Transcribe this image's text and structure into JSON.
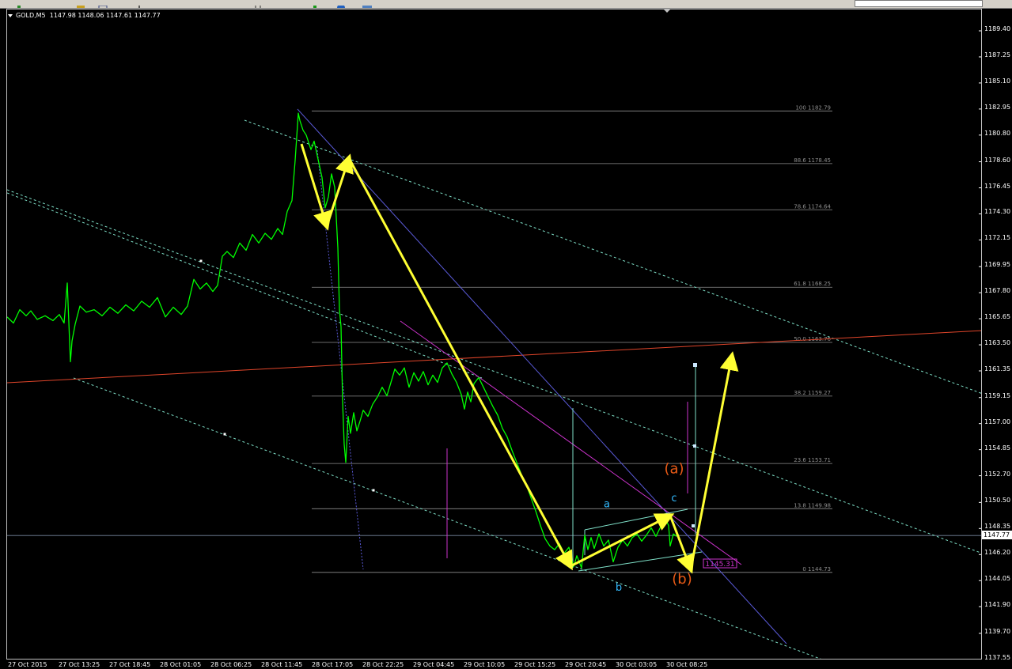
{
  "header": {
    "symbol": "GOLD,M5",
    "ohlc": "1147.98 1148.06 1147.61 1147.77"
  },
  "toolbar": {
    "buttons": [
      "new-chart-icon",
      "profiles-icon",
      "crosshair-icon",
      "zoom-in-icon",
      "zoom-out-icon",
      "period-icon",
      "new-order-icon",
      "autotrading-icon",
      "indicators-icon"
    ]
  },
  "colors": {
    "background": "#000000",
    "price_line": "#00ff00",
    "wave_arrow": "#ffff33",
    "fib_level": "#8e8e8e",
    "channel": "#7fe0c8",
    "trendline_blue": "#5a5ad8",
    "trendline_magenta": "#cc33cc",
    "trendline_red": "#e0452a",
    "label_orange": "#e85a16",
    "label_cyan": "#33bbff",
    "axis_text": "#ffffff"
  },
  "chart_data": {
    "type": "line",
    "title": "GOLD,M5",
    "y_axis": {
      "ticks": [
        "1189.40",
        "1187.25",
        "1185.10",
        "1182.95",
        "1180.80",
        "1178.60",
        "1176.45",
        "1174.30",
        "1172.15",
        "1169.95",
        "1167.80",
        "1165.65",
        "1163.50",
        "1161.35",
        "1159.15",
        "1157.00",
        "1154.85",
        "1152.70",
        "1150.50",
        "1148.35",
        "1146.20",
        "1144.05",
        "1141.90",
        "1139.70",
        "1137.55"
      ],
      "current_price": "1147.77",
      "ylim": [
        1137.0,
        1190.5
      ]
    },
    "x_axis": {
      "ticks": [
        "27 Oct 2015",
        "27 Oct 13:25",
        "27 Oct 18:45",
        "28 Oct 01:05",
        "28 Oct 06:25",
        "28 Oct 11:45",
        "28 Oct 17:05",
        "28 Oct 22:25",
        "29 Oct 04:45",
        "29 Oct 10:05",
        "29 Oct 15:25",
        "29 Oct 20:45",
        "30 Oct 03:05",
        "30 Oct 08:25"
      ]
    },
    "series": [
      {
        "values": [
          [
            0,
            1165.8
          ],
          [
            8,
            1165.3
          ],
          [
            16,
            1166.4
          ],
          [
            24,
            1165.9
          ],
          [
            30,
            1166.3
          ],
          [
            38,
            1165.6
          ],
          [
            48,
            1165.9
          ],
          [
            58,
            1165.5
          ],
          [
            66,
            1166.0
          ],
          [
            72,
            1165.3
          ],
          [
            76,
            1168.6
          ],
          [
            80,
            1162.1
          ],
          [
            82,
            1163.8
          ],
          [
            86,
            1165.2
          ],
          [
            92,
            1166.7
          ],
          [
            100,
            1166.2
          ],
          [
            110,
            1166.4
          ],
          [
            120,
            1165.9
          ],
          [
            130,
            1166.6
          ],
          [
            140,
            1166.1
          ],
          [
            150,
            1166.8
          ],
          [
            160,
            1166.3
          ],
          [
            170,
            1167.1
          ],
          [
            180,
            1166.6
          ],
          [
            190,
            1167.4
          ],
          [
            200,
            1165.8
          ],
          [
            210,
            1166.6
          ],
          [
            220,
            1166.0
          ],
          [
            228,
            1166.7
          ],
          [
            236,
            1168.9
          ],
          [
            244,
            1168.1
          ],
          [
            252,
            1168.6
          ],
          [
            260,
            1167.9
          ],
          [
            266,
            1168.4
          ],
          [
            272,
            1170.8
          ],
          [
            278,
            1171.2
          ],
          [
            286,
            1170.7
          ],
          [
            294,
            1171.9
          ],
          [
            302,
            1171.3
          ],
          [
            310,
            1172.6
          ],
          [
            318,
            1171.9
          ],
          [
            326,
            1172.7
          ],
          [
            334,
            1172.2
          ],
          [
            342,
            1173.1
          ],
          [
            348,
            1172.6
          ],
          [
            354,
            1174.5
          ],
          [
            360,
            1175.4
          ],
          [
            364,
            1178.7
          ],
          [
            368,
            1182.6
          ],
          [
            370,
            1182.0
          ],
          [
            374,
            1181.2
          ],
          [
            378,
            1180.8
          ],
          [
            384,
            1179.6
          ],
          [
            388,
            1180.3
          ],
          [
            394,
            1178.5
          ],
          [
            398,
            1177.3
          ],
          [
            402,
            1174.8
          ],
          [
            406,
            1175.7
          ],
          [
            410,
            1177.6
          ],
          [
            414,
            1176.5
          ],
          [
            418,
            1171.5
          ],
          [
            420,
            1166.4
          ],
          [
            422,
            1165.0
          ],
          [
            424,
            1158.8
          ],
          [
            426,
            1155.3
          ],
          [
            428,
            1153.8
          ],
          [
            431,
            1157.6
          ],
          [
            434,
            1156.2
          ],
          [
            438,
            1157.9
          ],
          [
            442,
            1156.4
          ],
          [
            446,
            1157.2
          ],
          [
            450,
            1158.1
          ],
          [
            456,
            1157.6
          ],
          [
            462,
            1158.6
          ],
          [
            468,
            1159.2
          ],
          [
            474,
            1160.0
          ],
          [
            480,
            1159.3
          ],
          [
            486,
            1160.6
          ],
          [
            490,
            1161.5
          ],
          [
            496,
            1161.0
          ],
          [
            502,
            1161.6
          ],
          [
            508,
            1160.0
          ],
          [
            514,
            1161.2
          ],
          [
            520,
            1160.5
          ],
          [
            526,
            1161.3
          ],
          [
            532,
            1160.2
          ],
          [
            538,
            1161.0
          ],
          [
            544,
            1160.4
          ],
          [
            550,
            1161.6
          ],
          [
            556,
            1162.0
          ],
          [
            562,
            1161.1
          ],
          [
            568,
            1160.4
          ],
          [
            574,
            1159.4
          ],
          [
            578,
            1158.2
          ],
          [
            582,
            1159.6
          ],
          [
            586,
            1158.8
          ],
          [
            590,
            1160.3
          ],
          [
            596,
            1160.8
          ],
          [
            602,
            1160.0
          ],
          [
            608,
            1159.2
          ],
          [
            614,
            1158.4
          ],
          [
            620,
            1157.7
          ],
          [
            626,
            1156.6
          ],
          [
            632,
            1155.9
          ],
          [
            638,
            1154.8
          ],
          [
            644,
            1153.8
          ],
          [
            650,
            1152.8
          ],
          [
            656,
            1152.0
          ],
          [
            662,
            1150.9
          ],
          [
            668,
            1149.8
          ],
          [
            674,
            1148.6
          ],
          [
            680,
            1147.5
          ],
          [
            686,
            1146.9
          ],
          [
            692,
            1146.6
          ],
          [
            698,
            1147.1
          ],
          [
            704,
            1146.3
          ],
          [
            710,
            1146.8
          ],
          [
            716,
            1145.2
          ],
          [
            720,
            1146.1
          ],
          [
            726,
            1145.1
          ],
          [
            730,
            1147.8
          ],
          [
            734,
            1146.6
          ],
          [
            738,
            1147.6
          ],
          [
            742,
            1146.7
          ],
          [
            748,
            1147.9
          ],
          [
            754,
            1146.9
          ],
          [
            760,
            1147.4
          ],
          [
            766,
            1145.6
          ],
          [
            772,
            1146.8
          ],
          [
            778,
            1147.4
          ],
          [
            784,
            1146.9
          ],
          [
            790,
            1147.6
          ],
          [
            796,
            1147.9
          ],
          [
            802,
            1147.3
          ],
          [
            808,
            1147.8
          ],
          [
            814,
            1148.4
          ],
          [
            820,
            1147.7
          ],
          [
            826,
            1148.5
          ],
          [
            832,
            1149.1
          ],
          [
            836,
            1148.6
          ],
          [
            838,
            1146.9
          ],
          [
            842,
            1147.9
          ],
          [
            846,
            1147.7
          ]
        ]
      }
    ],
    "fib_levels": [
      {
        "level": "100",
        "price": "1182.79",
        "label": "100 1182.79"
      },
      {
        "level": "88.6",
        "price": "1178.45",
        "label": "88.6 1178.45"
      },
      {
        "level": "78.6",
        "price": "1174.64",
        "label": "78.6 1174.64"
      },
      {
        "level": "61.8",
        "price": "1168.25",
        "label": "61.8 1168.25"
      },
      {
        "level": "50.0",
        "price": "1163.7",
        "label": "50.0 1163.76"
      },
      {
        "level": "38.2",
        "price": "1159.27",
        "label": "38.2 1159.27"
      },
      {
        "level": "23.6",
        "price": "1153.71",
        "label": "23.6 1153.71"
      },
      {
        "level": "13.8",
        "price": "1149.98",
        "label": "13.8 1149.98"
      },
      {
        "level": "0",
        "price": "1144.73",
        "label": "0 1144.73"
      }
    ],
    "annotations": {
      "wave_labels": [
        {
          "text": "(a)",
          "price": 1152.9,
          "x": 843,
          "color": "#e85a16"
        },
        {
          "text": "(b)",
          "price": 1143.8,
          "x": 853,
          "color": "#e85a16"
        },
        {
          "text": "a",
          "price": 1150.1,
          "x": 758,
          "color": "#33bbff"
        },
        {
          "text": "b",
          "price": 1143.2,
          "x": 773,
          "color": "#33bbff"
        },
        {
          "text": "c",
          "price": 1150.6,
          "x": 843,
          "color": "#33bbff"
        }
      ],
      "price_box": "1145.31"
    },
    "grid": false
  }
}
